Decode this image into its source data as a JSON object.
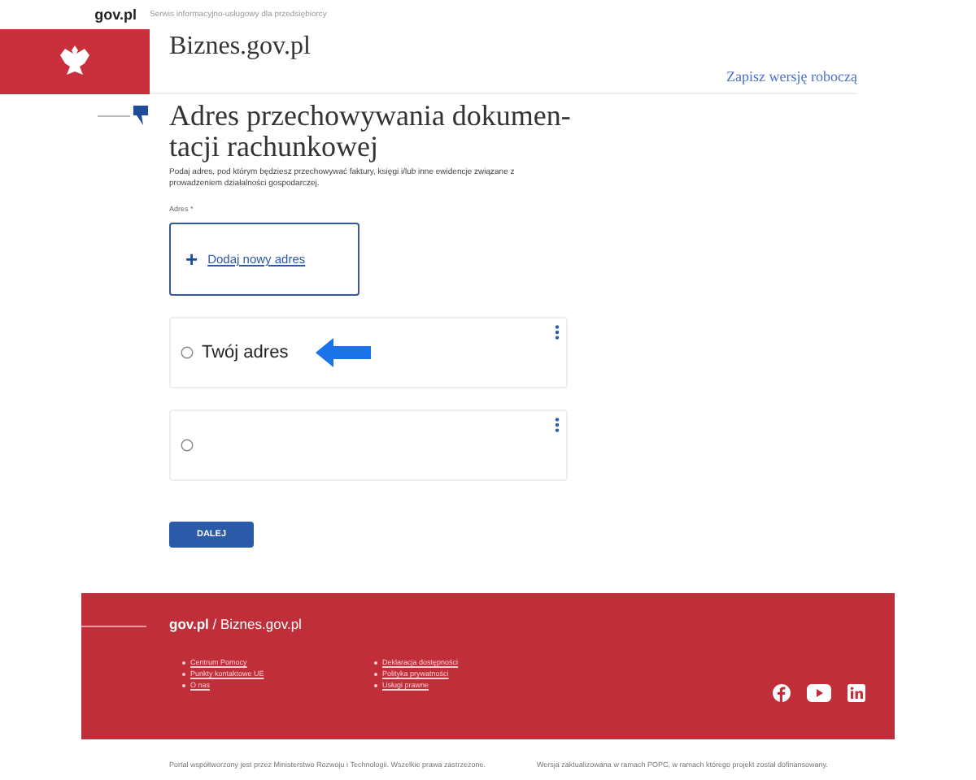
{
  "header": {
    "logo": "gov.pl",
    "tagline": "Serwis informacyjno-usługowy dla przedsiębiorcy",
    "site_title": "Biznes.gov.pl",
    "save_draft_link": "Zapisz wersję roboczą"
  },
  "form": {
    "title": "Adres przechowywania dokumen-tacji rachunkowej",
    "description": "Podaj adres, pod którym będziesz przechowywać faktury, księgi i/lub inne ewidencje związane z prowadzeniem działalności gospodarczej.",
    "field_label": "Adres *",
    "add_button": {
      "icon": "+",
      "label": "Dodaj nowy adres"
    },
    "options": [
      {
        "label": "Twój adres",
        "selected": false,
        "pointer_arrow": true
      },
      {
        "selected": false,
        "pointer_arrow": false
      }
    ],
    "next_button": "DALEJ"
  },
  "footer": {
    "brand": "gov.pl",
    "site": "/ Biznes.gov.pl",
    "links_left": [
      "Centrum Pomocy",
      "Punkty kontaktowe UE",
      "O nas"
    ],
    "links_right": [
      "Deklaracja dostępności",
      "Polityka prywatności",
      "Usługi prawne"
    ],
    "notes": [
      "Portal współtworzony jest przez Ministerstwo Rozwoju i Technologii. Wszelkie prawa zastrzeżone.",
      "Wersja zaktualizowana w ramach POPC, w ramach którego projekt został dofinansowany."
    ]
  }
}
